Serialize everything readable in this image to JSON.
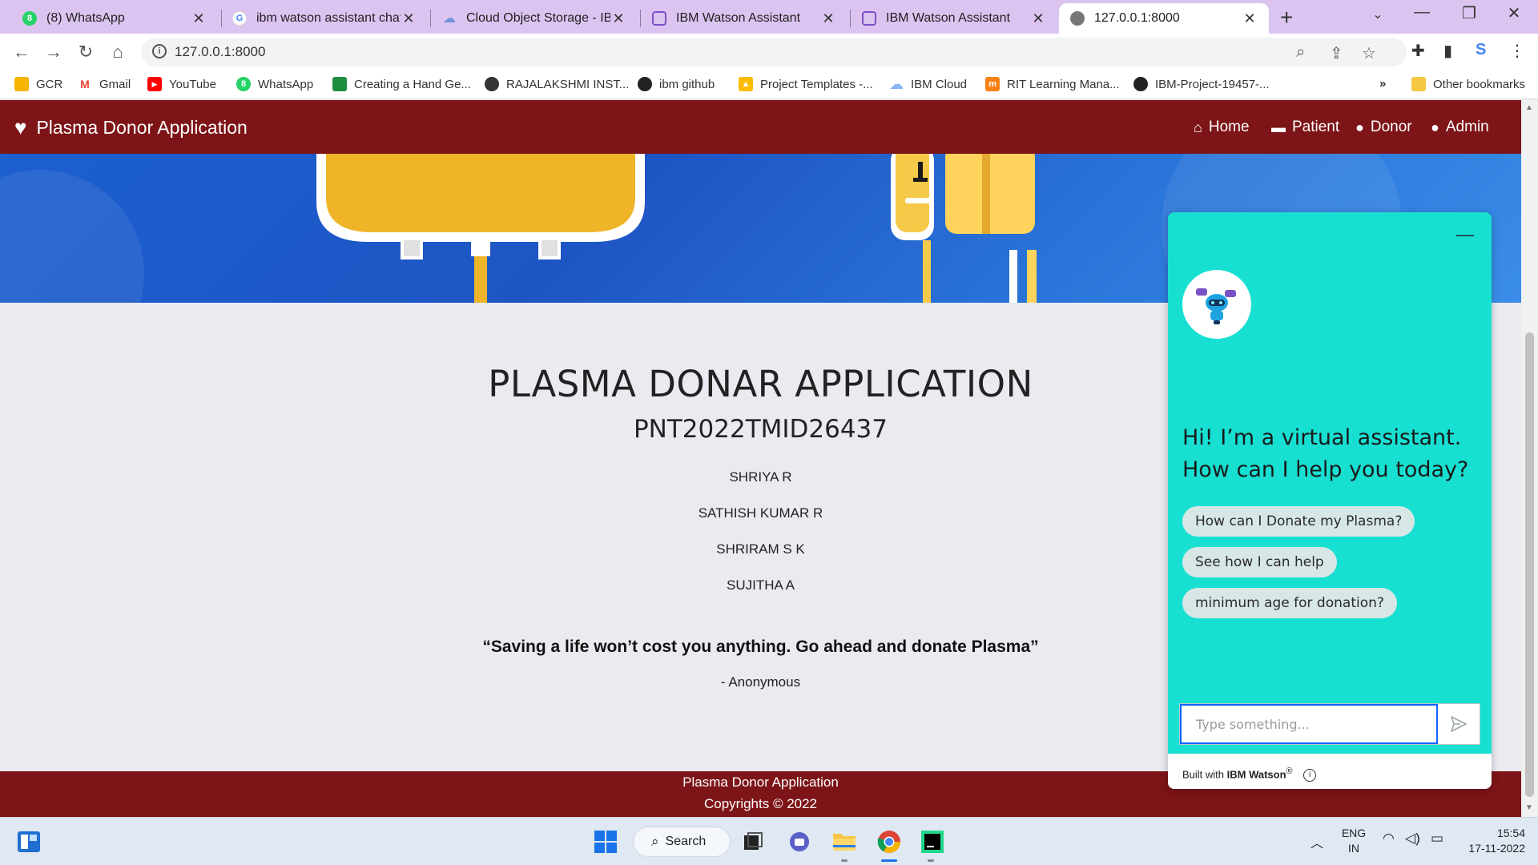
{
  "browser": {
    "tabs": [
      {
        "title": "(8) WhatsApp",
        "icon": "whatsapp-icon",
        "color": "#25d366",
        "badge": "8"
      },
      {
        "title": "ibm watson assistant chatb",
        "icon": "google-icon",
        "color": "#4285f4",
        "badge": "G"
      },
      {
        "title": "Cloud Object Storage - IBM",
        "icon": "cloud-icon",
        "color": "#6f8fd8",
        "badge": ""
      },
      {
        "title": "IBM Watson Assistant",
        "icon": "watson-assistant-icon",
        "color": "#7a52c7",
        "badge": ""
      },
      {
        "title": "IBM Watson Assistant",
        "icon": "watson-assistant-icon",
        "color": "#7a52c7",
        "badge": ""
      },
      {
        "title": "127.0.0.1:8000",
        "icon": "globe-icon",
        "color": "#666666",
        "badge": ""
      }
    ],
    "active_tab_index": 5,
    "url": "127.0.0.1:8000",
    "bookmarks": [
      {
        "label": "GCR",
        "icon": "gcr-icon",
        "color": "#f4b400"
      },
      {
        "label": "Gmail",
        "icon": "gmail-icon",
        "color": "#ea4335"
      },
      {
        "label": "YouTube",
        "icon": "youtube-icon",
        "color": "#ff0000"
      },
      {
        "label": "WhatsApp",
        "icon": "whatsapp-icon",
        "color": "#25d366"
      },
      {
        "label": "Creating a Hand Ge...",
        "icon": "doc-icon",
        "color": "#1e8e3e"
      },
      {
        "label": "RAJALAKSHMI INST...",
        "icon": "globe-icon",
        "color": "#333333"
      },
      {
        "label": "ibm github",
        "icon": "github-icon",
        "color": "#222222"
      },
      {
        "label": "Project Templates -...",
        "icon": "drive-icon",
        "color": "#fbbc04"
      },
      {
        "label": "IBM Cloud",
        "icon": "cloud-icon",
        "color": "#8ab4f8"
      },
      {
        "label": "RIT Learning Mana...",
        "icon": "moodle-icon",
        "color": "#f98012"
      },
      {
        "label": "IBM-Project-19457-...",
        "icon": "github-icon",
        "color": "#222222"
      }
    ],
    "more_bookmarks": "»",
    "other_bookmarks": "Other bookmarks"
  },
  "site": {
    "brand": "Plasma Donor Application",
    "nav": [
      {
        "label": "Home",
        "icon": "home-icon"
      },
      {
        "label": "Patient",
        "icon": "bed-icon"
      },
      {
        "label": "Donor",
        "icon": "user-icon"
      },
      {
        "label": "Admin",
        "icon": "user-cog-icon"
      }
    ],
    "title": "PLASMA DONAR APPLICATION",
    "team_id": "PNT2022TMID26437",
    "members": [
      "SHRIYA R",
      "SATHISH KUMAR R",
      "SHRIRAM S K",
      "SUJITHA A"
    ],
    "quote": "“Saving a life won’t cost you anything. Go ahead and donate Plasma”",
    "quote_author": "- Anonymous",
    "footer_line1": "Plasma Donor Application",
    "footer_line2": "Copyrights © 2022",
    "colors": {
      "primary": "#7d1417",
      "hero": "#1e55c4"
    }
  },
  "chat": {
    "greeting": "Hi! I’m a virtual assistant. How can I help you today?",
    "options": [
      "How can I Donate my Plasma?",
      "See how I can help",
      "minimum age for donation?"
    ],
    "input_placeholder": "Type something...",
    "built_with_prefix": "Built with ",
    "built_with_brand": "IBM Watson",
    "built_with_mark": "®",
    "color": "#17e0d2"
  },
  "taskbar": {
    "search_label": "Search",
    "lang": "ENG",
    "region": "IN",
    "time": "15:54",
    "date": "17-11-2022"
  }
}
